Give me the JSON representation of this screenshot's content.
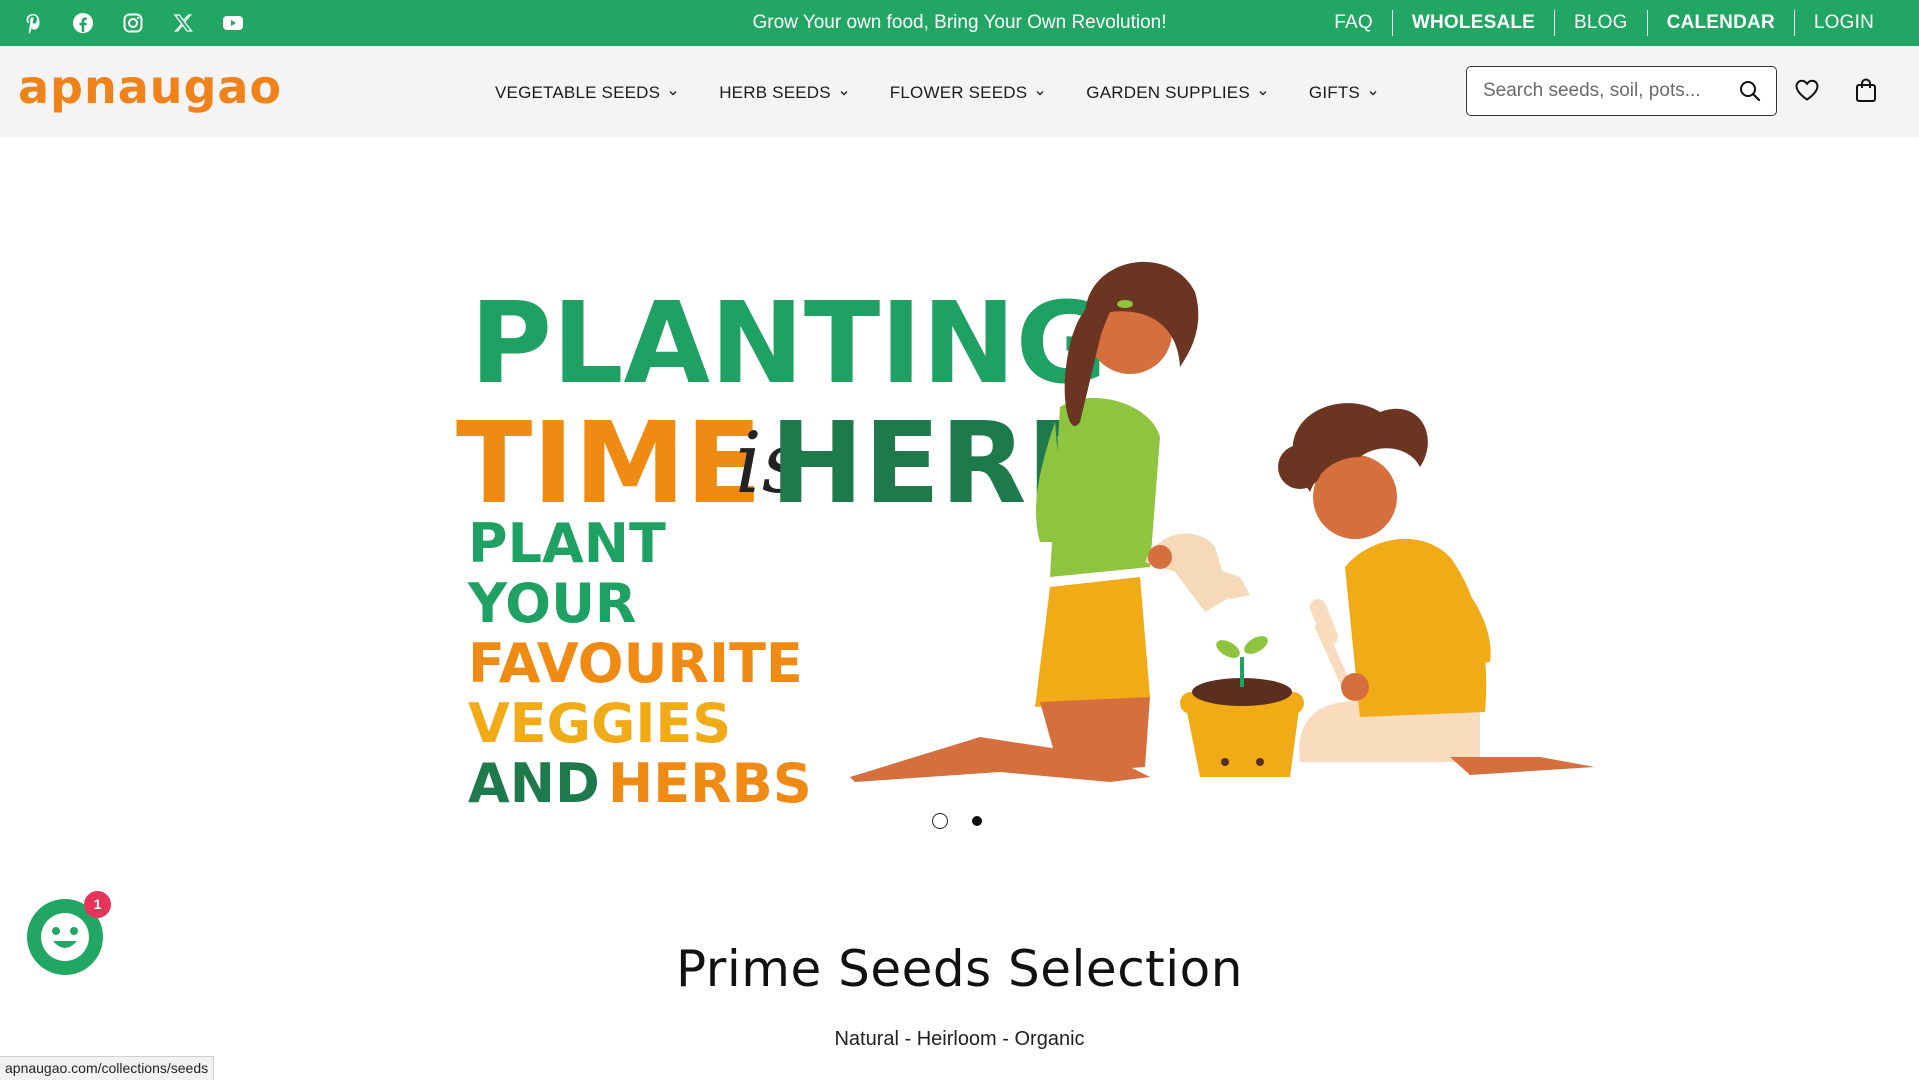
{
  "topbar": {
    "bg_color": "#22a663",
    "social_icons": [
      "pinterest-icon",
      "facebook-icon",
      "instagram-icon",
      "x-twitter-icon",
      "youtube-icon"
    ],
    "announcement": "Grow Your own food, Bring Your Own Revolution!",
    "links": [
      {
        "label": "FAQ"
      },
      {
        "label": "WHOLESALE"
      },
      {
        "label": "BLOG"
      },
      {
        "label": "CALENDAR"
      },
      {
        "label": "LOGIN"
      }
    ]
  },
  "header": {
    "logo": "apnaugao",
    "logo_color": "#f0821a",
    "nav": [
      {
        "label": "VEGETABLE SEEDS"
      },
      {
        "label": "HERB SEEDS"
      },
      {
        "label": "FLOWER SEEDS"
      },
      {
        "label": "GARDEN SUPPLIES"
      },
      {
        "label": "GIFTS"
      }
    ],
    "search_placeholder": "Search seeds, soil, pots...",
    "icons": [
      "search-icon",
      "heart-icon",
      "shopping-bag-icon"
    ]
  },
  "hero": {
    "line1": "PLANTING",
    "line2a": "TIME",
    "line2b": "is",
    "line2c": "HERE",
    "line3": "PLANT",
    "line4": "YOUR",
    "line5": "FAVOURITE",
    "line6": "VEGGIES",
    "line7a": "AND",
    "line7b": "HERBS",
    "colors": {
      "green": "#1fa163",
      "dark_green": "#1e7a4c",
      "orange": "#ef8a12",
      "yellow": "#f0ab16"
    },
    "slide_count": 2,
    "active_slide": 2
  },
  "section": {
    "title": "Prime Seeds Selection",
    "subtitle": "Natural - Heirloom - Organic"
  },
  "chat": {
    "badge_count": "1"
  },
  "status_url": "apnaugao.com/collections/seeds"
}
